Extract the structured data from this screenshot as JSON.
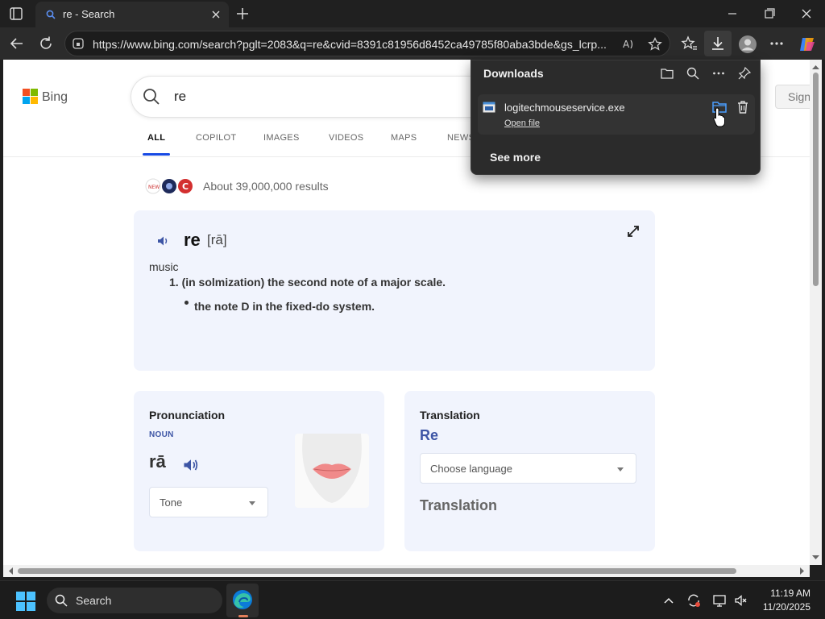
{
  "browser": {
    "tab_title": "re - Search",
    "url": "https://www.bing.com/search?pglt=2083&q=re&cvid=8391c81956d8452ca49785f80aba3bde&gs_lcrp..."
  },
  "page": {
    "logo_text": "Bing",
    "search_query": "re",
    "sign_in": "Sign",
    "nav_tabs": [
      "ALL",
      "COPILOT",
      "IMAGES",
      "VIDEOS",
      "MAPS",
      "NEWS"
    ],
    "results_count": "About 39,000,000 results",
    "dictionary": {
      "word": "re",
      "phonetic": "[rā]",
      "domain": "music",
      "definition_1": "1. (in solmization) the second note of a major scale.",
      "definition_2": "the note D in the fixed-do system."
    },
    "pronunciation": {
      "title": "Pronunciation",
      "part_of_speech": "NOUN",
      "word": "rā",
      "tone_label": "Tone"
    },
    "translation": {
      "title": "Translation",
      "word": "Re",
      "language_placeholder": "Choose language",
      "output_label": "Translation"
    }
  },
  "downloads": {
    "title": "Downloads",
    "item_filename": "logitechmouseservice.exe",
    "item_open": "Open file",
    "see_more": "See more"
  },
  "taskbar": {
    "search_label": "Search",
    "time": "11:19 AM",
    "date": "11/20/2025"
  },
  "colors": {
    "accent_blue": "#174ae4",
    "card_bg": "#f1f4fd",
    "bing_blue_text": "#3d55a5",
    "edge_indicator": "#e37f5b"
  }
}
